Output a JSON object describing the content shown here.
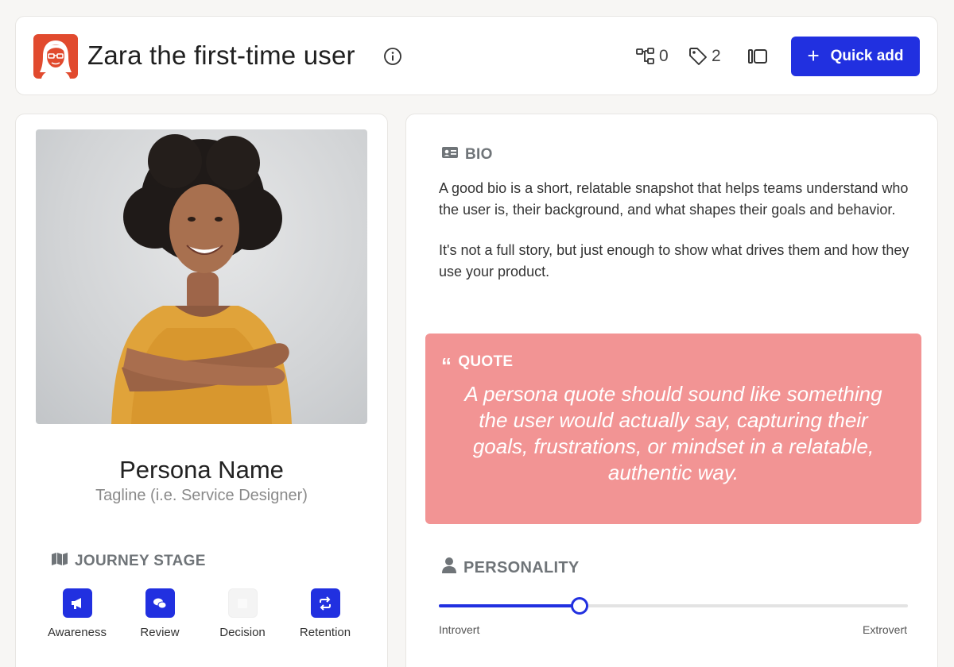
{
  "header": {
    "title": "Zara the first-time user",
    "connections_count": "0",
    "tags_count": "2",
    "quick_add_label": "Quick add",
    "icons": {
      "logo": "persona-avatar-logo",
      "info": "info-icon",
      "connections": "hierarchy-icon",
      "tags": "tag-icon",
      "panel": "sidebar-panel-icon",
      "add": "plus-icon"
    },
    "accent": "#2130e0",
    "logo_color": "#e14a2e"
  },
  "profile": {
    "photo": "portrait-photo",
    "name": "Persona Name",
    "tagline": "Tagline (i.e. Service Designer)"
  },
  "journey": {
    "heading": "JOURNEY STAGE",
    "stages": [
      {
        "label": "Awareness",
        "active": true,
        "icon": "megaphone-icon"
      },
      {
        "label": "Review",
        "active": true,
        "icon": "chat-bubbles-icon"
      },
      {
        "label": "Decision",
        "active": false,
        "icon": "square-icon"
      },
      {
        "label": "Retention",
        "active": true,
        "icon": "repeat-arrows-icon"
      }
    ]
  },
  "bio": {
    "heading": "BIO",
    "paragraphs": [
      "A good bio is a short, relatable snapshot that helps teams understand who the user is, their background, and what shapes their goals and behavior.",
      "It's not a full story, but just enough to show what drives them and how they use your product."
    ]
  },
  "quote": {
    "heading": "QUOTE",
    "text": "A persona quote should sound like something the user would actually say, capturing their goals, frustrations, or mindset in a relatable, authentic way.",
    "background": "#f29494"
  },
  "personality": {
    "heading": "PERSONALITY",
    "min_label": "Introvert",
    "max_label": "Extrovert",
    "value": 0.3
  }
}
